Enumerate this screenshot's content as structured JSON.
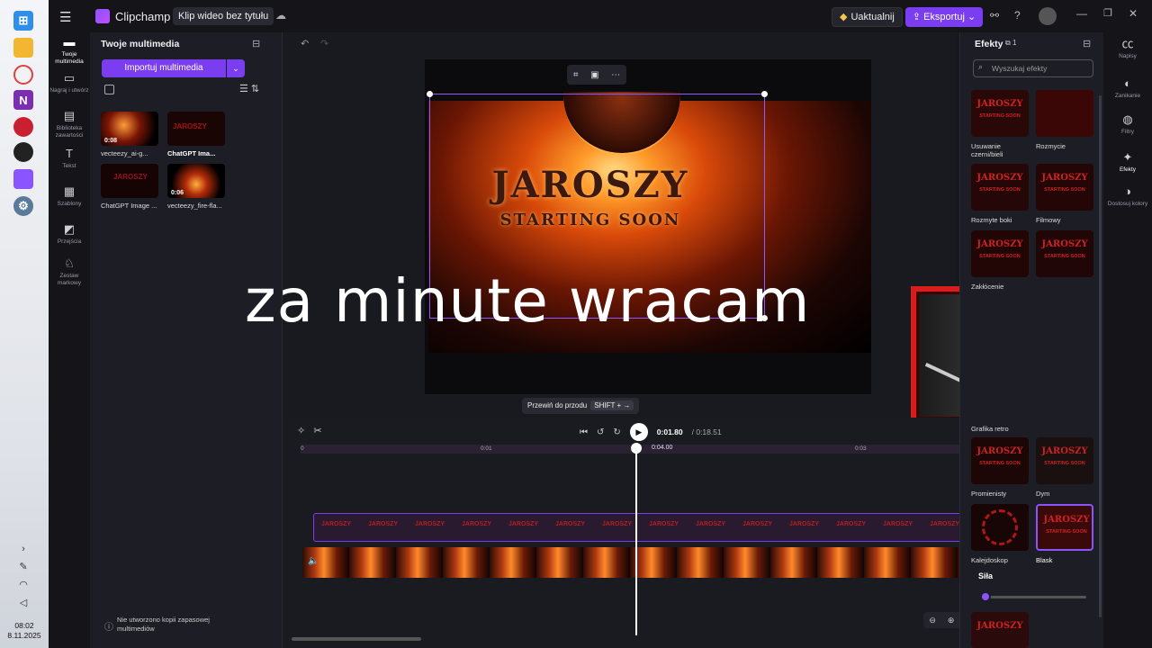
{
  "taskbar": {
    "clock_time": "08:02",
    "clock_date": "8.11.2025"
  },
  "titlebar": {
    "brand": "Clipchamp",
    "project_title": "Klip wideo bez tytułu",
    "upgrade_label": "Uaktualnij",
    "export_label": "Eksportuj"
  },
  "leftnav": {
    "items": [
      {
        "label": "Twoje multimedia",
        "icon": "folder-icon"
      },
      {
        "label": "Nagraj i utwórz",
        "icon": "camera-icon"
      },
      {
        "label": "Biblioteka zawartości",
        "icon": "library-icon"
      },
      {
        "label": "Tekst",
        "icon": "text-icon"
      },
      {
        "label": "Szablony",
        "icon": "templates-icon"
      },
      {
        "label": "Przejścia",
        "icon": "transitions-icon"
      },
      {
        "label": "Zestaw markowy",
        "icon": "brand-kit-icon"
      }
    ]
  },
  "media": {
    "title": "Twoje multimedia",
    "import_label": "Importuj multimedia",
    "items": [
      {
        "label": "vecteezy_ai-g...",
        "duration": "0:08"
      },
      {
        "label": "ChatGPT Ima...",
        "duration": ""
      },
      {
        "label": "ChatGPT Image ...",
        "duration": ""
      },
      {
        "label": "vecteezy_fire-fla...",
        "duration": "0:06"
      }
    ],
    "backup_note": "Nie utworzono kopii zapasowej multimediów"
  },
  "preview": {
    "image_title": "JAROSZY",
    "image_subtitle": "STARTING SOON",
    "overlay_text": "za minute wracam",
    "tooltip_label": "Przewiń do przodu",
    "tooltip_shortcut": "SHIFT + →"
  },
  "timeline": {
    "current_time": "0:01.80",
    "total_time": "/ 0:18.51",
    "playhead_time": "0:04.00",
    "ruler_ticks": [
      "0",
      "0:01",
      "0:03"
    ],
    "overlay_clip_text": "JAROSZY"
  },
  "effects": {
    "title": "Efekty",
    "count": "1",
    "search_placeholder": "Wyszukaj efekty",
    "tile_title": "JAROSZY",
    "tile_sub": "STARTING SOON",
    "items": [
      {
        "label": "Usuwanie czerni/bieli"
      },
      {
        "label": "Rozmycie"
      },
      {
        "label": "Rozmyte boki"
      },
      {
        "label": "Filmowy"
      },
      {
        "label": "Zakłócenie"
      },
      {
        "label": "Grafika retro"
      },
      {
        "label": "Promienisty"
      },
      {
        "label": "Dym"
      },
      {
        "label": "Kalejdoskop"
      },
      {
        "label": "Blask"
      }
    ],
    "strength_label": "Siła",
    "strength_value": 0.05
  },
  "rightbar": {
    "items": [
      {
        "label": "Napisy"
      },
      {
        "label": "Zanikanie"
      },
      {
        "label": "Filtry"
      },
      {
        "label": "Efekty"
      },
      {
        "label": "Dostosuj kolory"
      }
    ]
  },
  "colors": {
    "accent": "#7b3df0",
    "webcam_frame": "#d81d1d"
  }
}
